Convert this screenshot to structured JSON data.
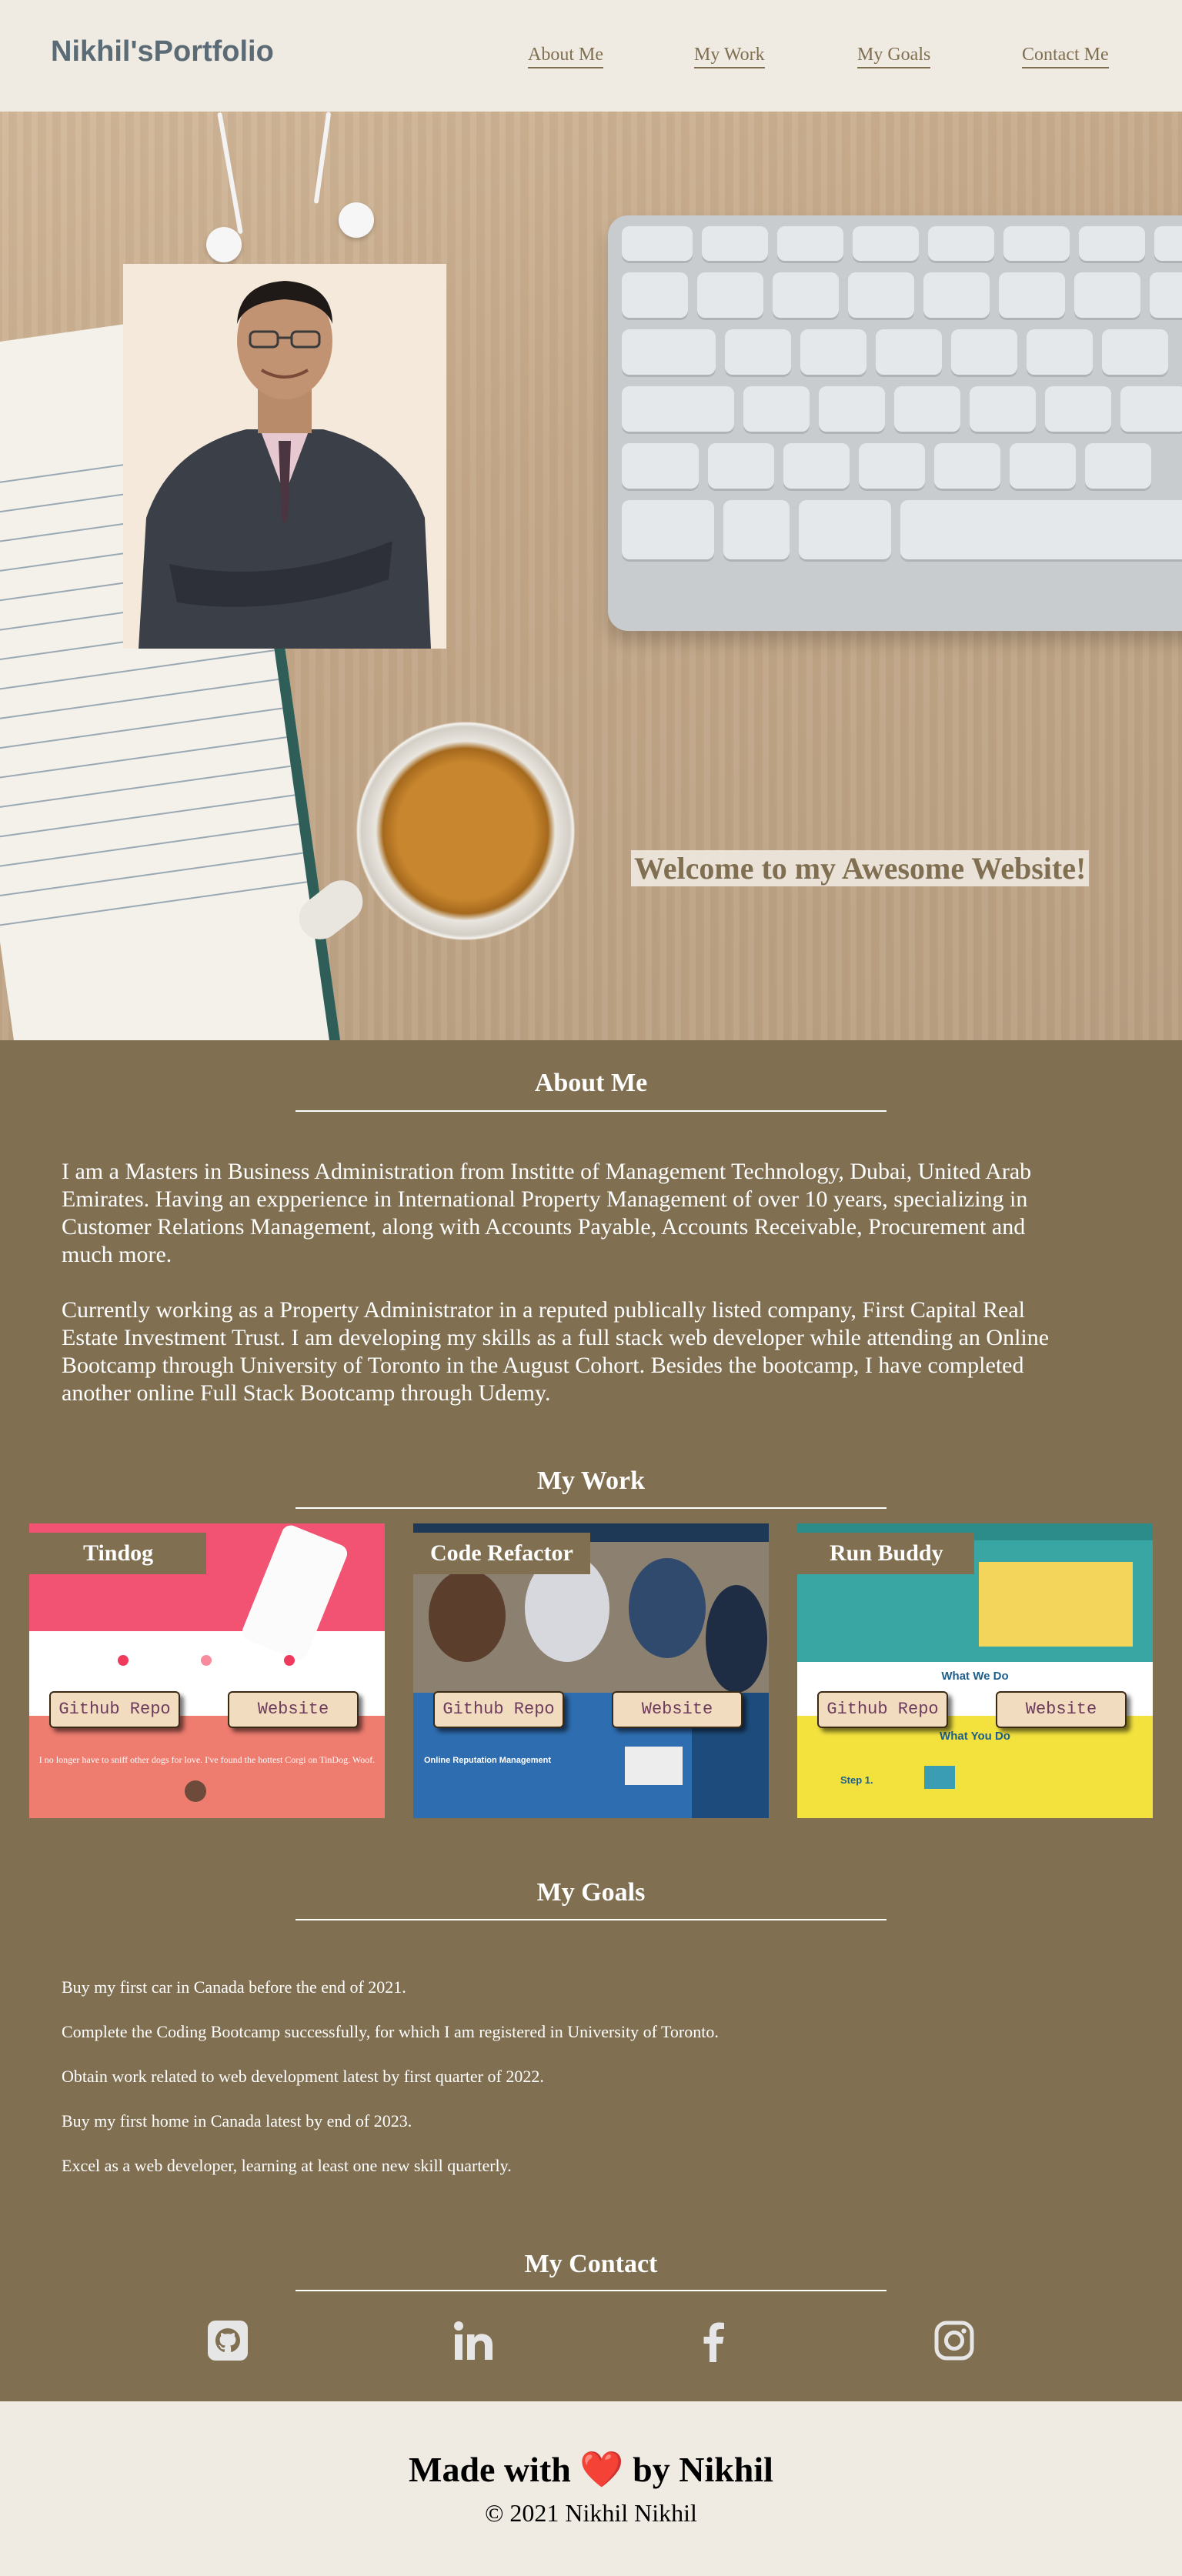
{
  "header": {
    "logo": "Nikhil'sPortfolio",
    "nav": [
      "About Me",
      "My Work",
      "My Goals",
      "Contact Me"
    ]
  },
  "hero": {
    "welcome": "Welcome to my Awesome Website!"
  },
  "about": {
    "title": "About Me",
    "paragraphs": [
      "I am a Masters in Business Administration from Institte of Management Technology, Dubai, United Arab Emirates. Having an expperience in International Property Management of over 10 years, specializing in Customer Relations Management, along with Accounts Payable, Accounts Receivable, Procurement and much more.",
      "Currently working as a Property Administrator in a reputed publically listed company, First Capital Real Estate Investment Trust. I am developing my skills as a full stack web developer while attending an Online Bootcamp through University of Toronto in the August Cohort. Besides the bootcamp, I have completed another online Full Stack Bootcamp through Udemy."
    ]
  },
  "work": {
    "title": "My Work",
    "projects": [
      {
        "name": "Tindog",
        "repo_label": "Github Repo",
        "site_label": "Website",
        "preview_text": "I no longer have to sniff other dogs for love. I've found the hottest Corgi on TinDog. Woof."
      },
      {
        "name": "Code Refactor",
        "repo_label": "Github Repo",
        "site_label": "Website",
        "preview_text": "Online Reputation Management"
      },
      {
        "name": "Run Buddy",
        "repo_label": "Github Repo",
        "site_label": "Website",
        "preview_text": "What We Do",
        "preview_text_2": "What You Do",
        "preview_text_3": "Step 1."
      }
    ]
  },
  "goals": {
    "title": "My Goals",
    "items": [
      "Buy my first car in Canada before the end of 2021.",
      "Complete the Coding Bootcamp successfully, for which I am registered in University of Toronto.",
      "Obtain work related to web development latest by first quarter of 2022.",
      "Buy my first home in Canada latest by end of 2023.",
      "Excel as a web developer, learning at least one new skill quarterly."
    ]
  },
  "contact": {
    "title": "My Contact",
    "icons": [
      "github-icon",
      "linkedin-icon",
      "facebook-icon",
      "instagram-icon"
    ]
  },
  "footer": {
    "made": "Made with ❤️ by Nikhil",
    "copyright": "© 2021 Nikhil Nikhil"
  },
  "colors": {
    "brown": "#806f51",
    "cream": "#f0ebe2",
    "slate": "#5a6b76"
  }
}
